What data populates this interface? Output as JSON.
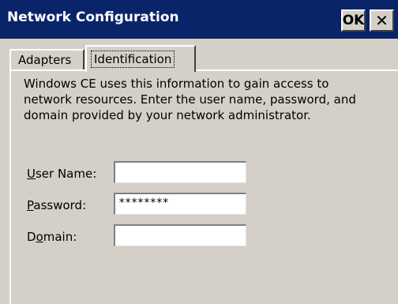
{
  "window": {
    "title": "Network Configuration",
    "ok_label": "OK",
    "close_label": "✕"
  },
  "tabs": [
    {
      "label": "Adapters",
      "active": false
    },
    {
      "label": "Identification",
      "active": true
    }
  ],
  "content": {
    "description_lines": [
      "Windows CE uses this information to gain access to",
      "network resources. Enter the user name, password, and",
      "domain provided by your network administrator."
    ],
    "fields": {
      "user_name": {
        "label_accel": "U",
        "label_rest": "ser Name:",
        "value": ""
      },
      "password": {
        "label_accel": "P",
        "label_rest": "assword:",
        "value": "********"
      },
      "domain": {
        "label_pre": "D",
        "label_accel": "o",
        "label_rest": "main:",
        "value": ""
      }
    }
  },
  "colors": {
    "titlebar": "#0a246a",
    "face": "#d4d0c8"
  }
}
